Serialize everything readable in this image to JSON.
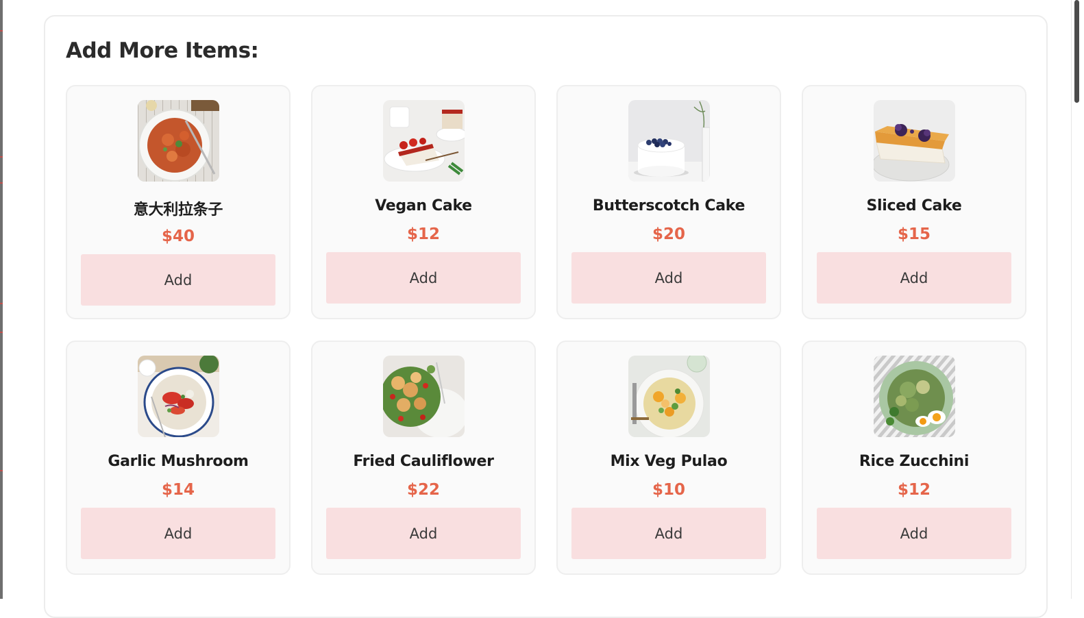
{
  "panel": {
    "title": "Add More Items:"
  },
  "items": [
    {
      "name": "意大利拉条子",
      "price": "$40",
      "add_label": "Add",
      "image": "pasta-plate-image"
    },
    {
      "name": "Vegan Cake",
      "price": "$12",
      "add_label": "Add",
      "image": "strawberry-cheesecake-image"
    },
    {
      "name": "Butterscotch Cake",
      "price": "$20",
      "add_label": "Add",
      "image": "white-blueberry-cake-image"
    },
    {
      "name": "Sliced Cake",
      "price": "$15",
      "add_label": "Add",
      "image": "caramel-cheesecake-slice-image"
    },
    {
      "name": "Garlic Mushroom",
      "price": "$14",
      "add_label": "Add",
      "image": "tomato-salad-plate-image"
    },
    {
      "name": "Fried Cauliflower",
      "price": "$22",
      "add_label": "Add",
      "image": "cauliflower-salad-image"
    },
    {
      "name": "Mix Veg Pulao",
      "price": "$10",
      "add_label": "Add",
      "image": "veg-pulao-plate-image"
    },
    {
      "name": "Rice Zucchini",
      "price": "$12",
      "add_label": "Add",
      "image": "zucchini-egg-plate-image"
    }
  ],
  "colors": {
    "price": "#e5654a",
    "add_button_bg": "#f9dfe0",
    "card_bg": "#fafafa"
  }
}
